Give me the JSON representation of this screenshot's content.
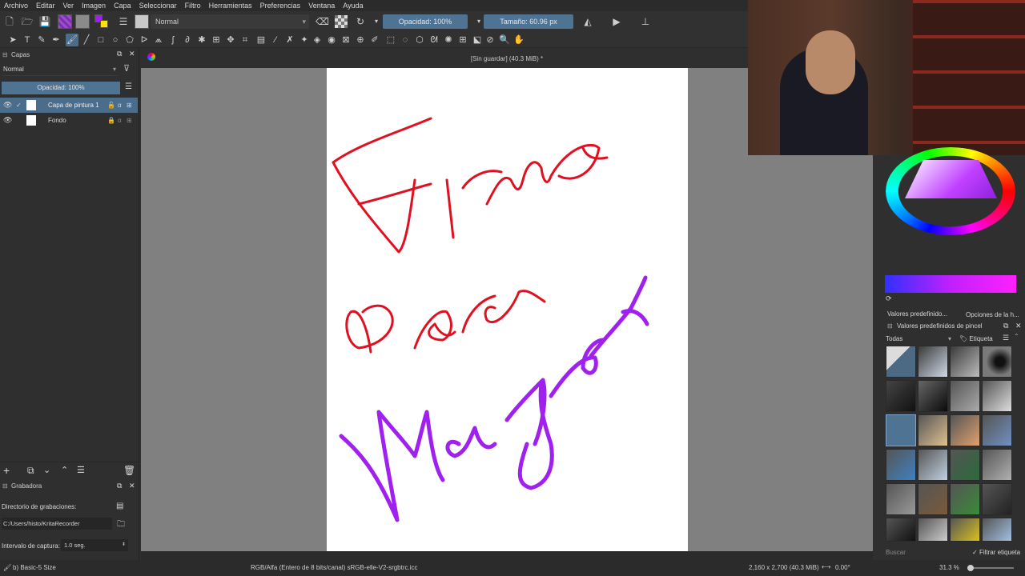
{
  "menu": [
    "Archivo",
    "Editar",
    "Ver",
    "Imagen",
    "Capa",
    "Seleccionar",
    "Filtro",
    "Herramientas",
    "Preferencias",
    "Ventana",
    "Ayuda"
  ],
  "toolbar": {
    "blend_mode": "Normal",
    "opacity": "Opacidad: 100%",
    "size": "Tamaño: 60.96 px"
  },
  "document": {
    "title": "[Sin guardar]  (40.3 MiB) *"
  },
  "layers_panel": {
    "title": "Capas",
    "blend_mode": "Normal",
    "opacity": "Opacidad:  100%",
    "layers": [
      {
        "name": "Capa de pintura 1"
      },
      {
        "name": "Fondo"
      }
    ]
  },
  "recorder": {
    "title": "Grabadora",
    "dir_label": "Directorio de grabaciones:",
    "dir_value": "C:/Users/histo/KritaRecorder",
    "interval_label": "Intervalo de captura:",
    "interval_value": "1.0 seg."
  },
  "right_panel": {
    "tab_presets": "Valores predefinido...",
    "tab_options": "Opciones de la h...",
    "presets_title": "Valores predefinidos de pincel",
    "filter_all": "Todas",
    "tag_label": "Etiqueta",
    "search_placeholder": "Buscar",
    "filter_tag": "Filtrar etiqueta"
  },
  "status": {
    "brush": "b) Basic-5 Size",
    "color_space": "RGB/Alfa (Entero de 8 bits/canal)  sRGB-elle-V2-srgbtrc.icc",
    "dimensions": "2,160 x 2,700 (40.3 MiB)",
    "rotation": "0.00°",
    "zoom": "31.3 %"
  },
  "colors": {
    "accent": "#4a6d8c",
    "red_ink": "#e01020",
    "purple_ink": "#a020f0"
  }
}
